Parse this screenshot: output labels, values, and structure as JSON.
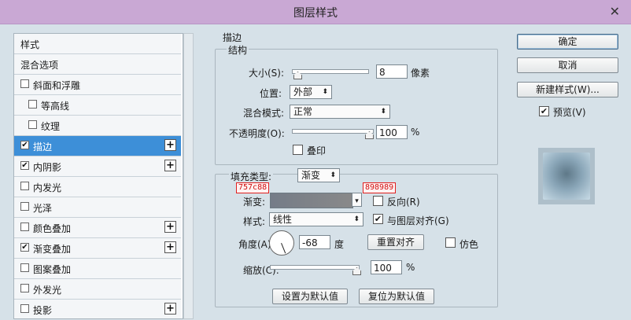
{
  "window": {
    "title": "图层样式",
    "close_glyph": "✕"
  },
  "left_panel": {
    "items": [
      {
        "label": "样式",
        "checkbox": false,
        "checked": false,
        "plus": false,
        "indent": false,
        "active": false
      },
      {
        "label": "混合选项",
        "checkbox": false,
        "checked": false,
        "plus": false,
        "indent": false,
        "active": false
      },
      {
        "label": "斜面和浮雕",
        "checkbox": true,
        "checked": false,
        "plus": false,
        "indent": false,
        "active": false
      },
      {
        "label": "等高线",
        "checkbox": true,
        "checked": false,
        "plus": false,
        "indent": true,
        "active": false
      },
      {
        "label": "纹理",
        "checkbox": true,
        "checked": false,
        "plus": false,
        "indent": true,
        "active": false
      },
      {
        "label": "描边",
        "checkbox": true,
        "checked": true,
        "plus": true,
        "indent": false,
        "active": true
      },
      {
        "label": "内阴影",
        "checkbox": true,
        "checked": true,
        "plus": true,
        "indent": false,
        "active": false
      },
      {
        "label": "内发光",
        "checkbox": true,
        "checked": false,
        "plus": false,
        "indent": false,
        "active": false
      },
      {
        "label": "光泽",
        "checkbox": true,
        "checked": false,
        "plus": false,
        "indent": false,
        "active": false
      },
      {
        "label": "颜色叠加",
        "checkbox": true,
        "checked": false,
        "plus": true,
        "indent": false,
        "active": false
      },
      {
        "label": "渐变叠加",
        "checkbox": true,
        "checked": true,
        "plus": true,
        "indent": false,
        "active": false
      },
      {
        "label": "图案叠加",
        "checkbox": true,
        "checked": false,
        "plus": false,
        "indent": false,
        "active": false
      },
      {
        "label": "外发光",
        "checkbox": true,
        "checked": false,
        "plus": false,
        "indent": false,
        "active": false
      },
      {
        "label": "投影",
        "checkbox": true,
        "checked": false,
        "plus": true,
        "indent": false,
        "active": false
      }
    ]
  },
  "stroke": {
    "section_title": "描边",
    "structure_title": "结构",
    "size_label": "大小(S):",
    "size_value": "8",
    "size_unit": "像素",
    "position_label": "位置:",
    "position_value": "外部",
    "blend_label": "混合模式:",
    "blend_value": "正常",
    "opacity_label": "不透明度(O):",
    "opacity_value": "100",
    "opacity_unit": "%",
    "overprint_label": "叠印",
    "fill_type_label": "填充类型:",
    "fill_type_value": "渐变",
    "gradient_label": "渐变:",
    "gradient_start_tag": "757c88",
    "gradient_end_tag": "898989",
    "reverse_label": "反向(R)",
    "style_label": "样式:",
    "style_value": "线性",
    "align_label": "与图层对齐(G)",
    "angle_label": "角度(A):",
    "angle_value": "-68",
    "angle_unit": "度",
    "reset_align_label": "重置对齐",
    "dither_label": "仿色",
    "scale_label": "缩放(C):",
    "scale_value": "100",
    "scale_unit": "%",
    "set_default_label": "设置为默认值",
    "reset_default_label": "复位为默认值"
  },
  "right_panel": {
    "ok_label": "确定",
    "cancel_label": "取消",
    "new_style_label": "新建样式(W)...",
    "preview_label": "预览(V)",
    "preview_checked": true
  },
  "colors": {
    "gradient_start": "#757c88",
    "gradient_end": "#898989",
    "active_item": "#3d8fd8",
    "titlebar": "#c9a8d4"
  },
  "icons": {
    "check": "✔",
    "plus": "+",
    "dropdown": "▾",
    "spinner": "⬍"
  }
}
